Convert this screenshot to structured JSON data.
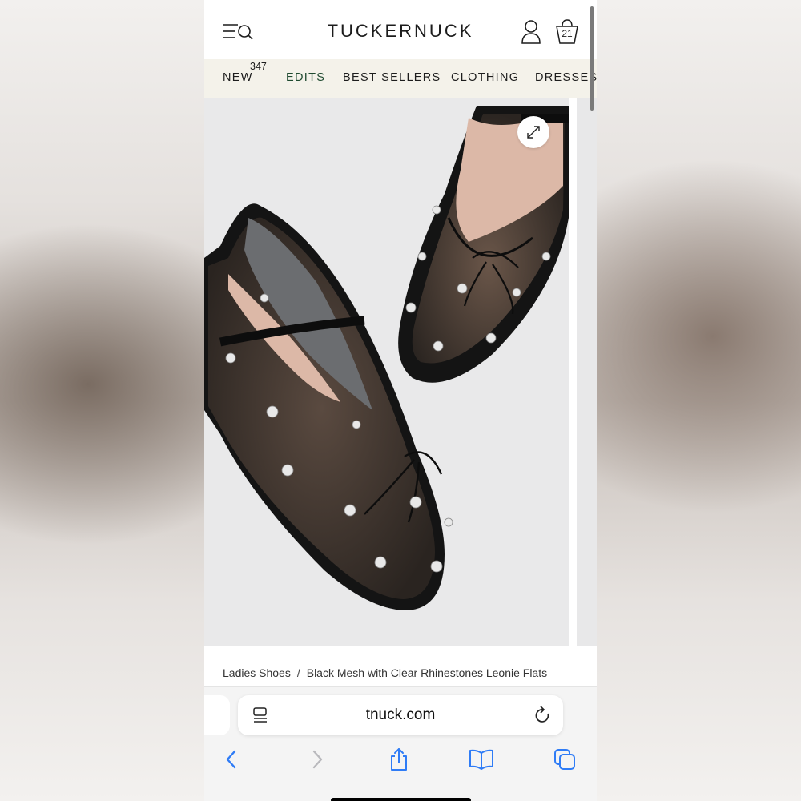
{
  "header": {
    "brand": "TUCKERNUCK",
    "bag_count": "21"
  },
  "nav": {
    "items": [
      {
        "label": "NEW",
        "badge": "347"
      },
      {
        "label": "EDITS"
      },
      {
        "label": "BEST SELLERS"
      },
      {
        "label": "CLOTHING"
      },
      {
        "label": "DRESSES"
      }
    ]
  },
  "gallery": {
    "image": "black-mesh-rhinestone-ballet-flats"
  },
  "breadcrumb": {
    "category": "Ladies Shoes",
    "separator": "/",
    "product": "Black Mesh with Clear Rhinestones Leonie Flats"
  },
  "browser": {
    "url": "tnuck.com"
  },
  "icons": {
    "menu": "menu-search-icon",
    "account": "user-icon",
    "bag": "shopping-bag-icon",
    "expand": "expand-icon",
    "reader": "reader-icon",
    "reload": "reload-icon",
    "back": "chevron-left-icon",
    "forward": "chevron-right-icon",
    "share": "share-icon",
    "bookmarks": "book-icon",
    "tabs": "tabs-icon"
  },
  "colors": {
    "nav_bg": "#f4f2ea",
    "nav_green": "#1f4a30",
    "ios_blue": "#2f7cf6"
  }
}
